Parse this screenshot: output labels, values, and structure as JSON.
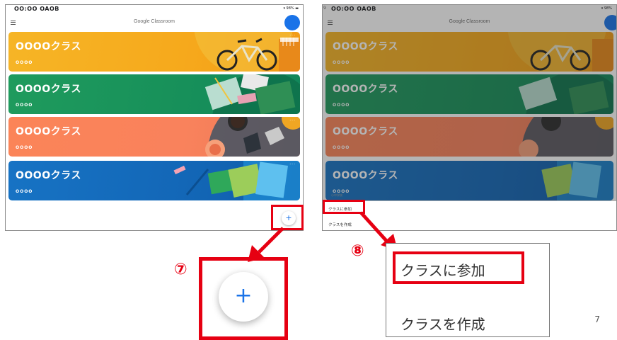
{
  "status": {
    "time": "OO:OO OAOB",
    "battery": "98%"
  },
  "left_screen": {
    "app_title": "Google Classroom",
    "classes": [
      {
        "name": "OOOOクラス",
        "section": "OOOO",
        "theme": "yellow"
      },
      {
        "name": "OOOOクラス",
        "section": "OOOO",
        "theme": "green"
      },
      {
        "name": "OOOOクラス",
        "section": "OOOO",
        "theme": "orange"
      },
      {
        "name": "OOOOクラス",
        "section": "OOOO",
        "theme": "blue"
      }
    ],
    "more_label": "···",
    "fab_label": "+"
  },
  "right_screen": {
    "app_title": "Google Classroom",
    "status_prefix": "9",
    "menu": {
      "hint": "小中学校",
      "join": "クラスに参加",
      "create": "クラスを作成"
    }
  },
  "callouts": {
    "step7": "⑦",
    "step8": "⑧",
    "zoom_fab": "+",
    "zoom_join": "クラスに参加",
    "zoom_create": "クラスを作成"
  },
  "page_number": "7",
  "colors": {
    "accent_red": "#e60012",
    "classroom_blue": "#1a73e8",
    "yellow": "#f6b526",
    "green": "#1f9b5d",
    "orange": "#fb8458",
    "blue": "#1773c4"
  }
}
